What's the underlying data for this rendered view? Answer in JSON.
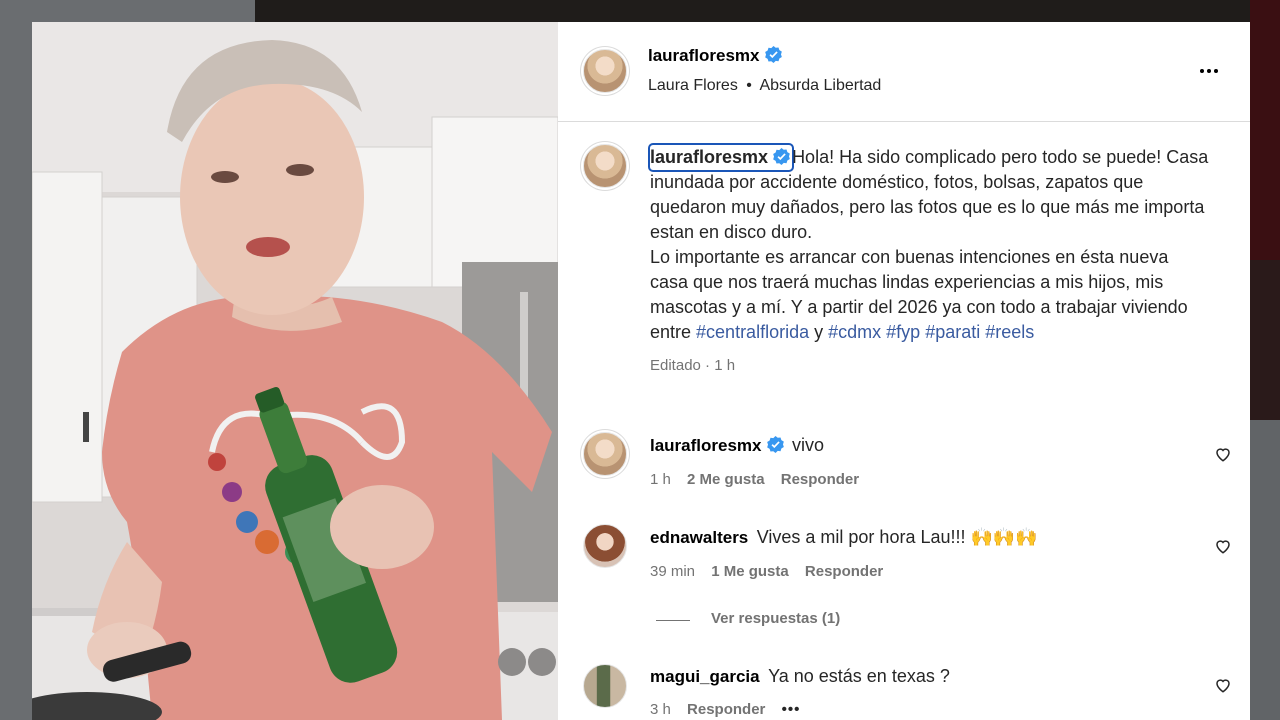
{
  "post": {
    "author": "laurafloresmx",
    "subtitle_name": "Laura Flores",
    "subtitle_sep": "•",
    "subtitle_audio": "Absurda Libertad"
  },
  "caption": {
    "author": "laurafloresmx",
    "text_1": "Hola! Ha sido complicado pero todo se puede! Casa inundada por accidente doméstico, fotos, bolsas, zapatos que quedaron muy dañados, pero las fotos que es lo que más me importa estan en disco duro.",
    "text_2": "Lo importante es arrancar con buenas intenciones en ésta nueva casa que nos traerá muchas lindas experiencias a mis hijos, mis mascotas y a mí. Y a partir del 2026 ya con todo a trabajar viviendo entre ",
    "hashtag_1": "#centralflorida",
    "connector": " y ",
    "hashtag_2": "#cdmx",
    "hashtag_3": "#fyp",
    "hashtag_4": "#parati",
    "hashtag_5": "#reels",
    "meta": "Editado · 1 h"
  },
  "comments": [
    {
      "user": "laurafloresmx",
      "verified": true,
      "text": "vivo",
      "time": "1 h",
      "likes": "2 Me gusta",
      "reply": "Responder"
    },
    {
      "user": "ednawalters",
      "verified": false,
      "text": "Vives a mil por hora Lau!!! 🙌🙌🙌",
      "time": "39 min",
      "likes": "1 Me gusta",
      "reply": "Responder"
    },
    {
      "user": "magui_garcia",
      "verified": false,
      "text": "Ya no estás en texas ?",
      "time": "3 h",
      "reply": "Responder"
    }
  ],
  "view_replies": "Ver respuestas (1)",
  "colors": {
    "verified": "#3897f0",
    "hashtag": "#3a5ba0",
    "focus": "#1a56b8"
  }
}
